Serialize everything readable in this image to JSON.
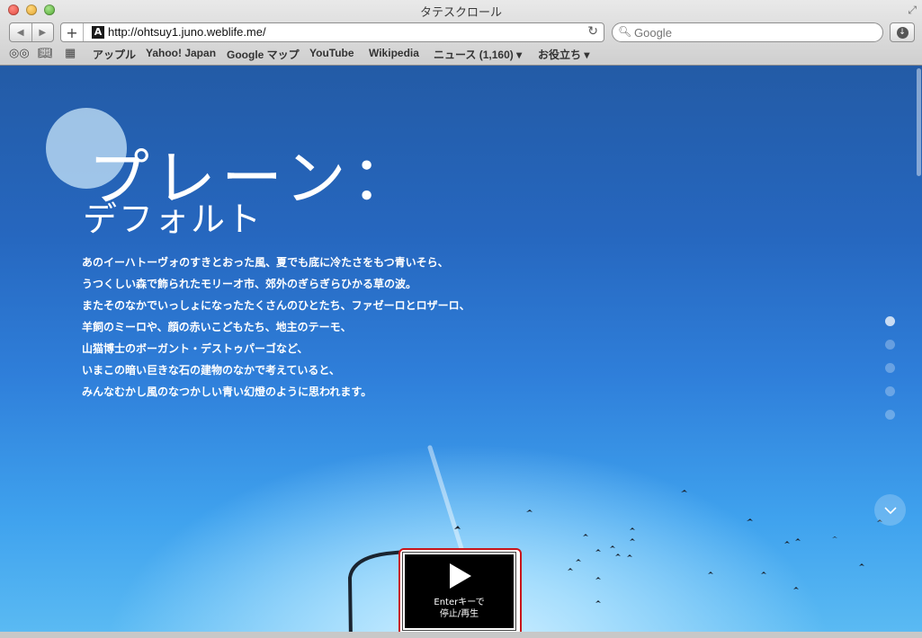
{
  "window": {
    "title": "タテスクロール"
  },
  "toolbar": {
    "back_icon": "back-arrow-icon",
    "forward_icon": "forward-arrow-icon",
    "add_label": "+",
    "url": "http://ohtsuy1.juno.weblife.me/",
    "favicon_letter": "A",
    "search_placeholder": "Google"
  },
  "bookmarks": {
    "items": [
      "アップル",
      "Yahoo! Japan",
      "Google マップ",
      "YouTube",
      "Wikipedia",
      "ニュース (1,160)",
      "お役立ち"
    ]
  },
  "hero": {
    "title": "プレーン：",
    "subtitle": "デフォルト",
    "body": [
      "あのイーハトーヴォのすきとおった風、夏でも底に冷たさをもつ青いそら、",
      "うつくしい森で飾られたモリーオ市、郊外のぎらぎらひかる草の波。",
      "またそのなかでいっしょになったたくさんのひとたち、ファゼーロとロザーロ、",
      "羊飼のミーロや、顔の赤いこどもたち、地主のテーモ、",
      "山猫博士のボーガント・デストゥパーゴなど、",
      "いまこの暗い巨きな石の建物のなかで考えていると、",
      "みんなむかし風のなつかしい青い幻燈のように思われます。"
    ]
  },
  "pager": {
    "count": 5,
    "active_index": 0
  },
  "media": {
    "line1": "Enterキーで",
    "line2": "停止/再生",
    "icon": "play-icon"
  },
  "colors": {
    "accent_frame": "#c9151b",
    "sky_top": "#235ba6",
    "sky_bottom": "#5abaf3"
  }
}
